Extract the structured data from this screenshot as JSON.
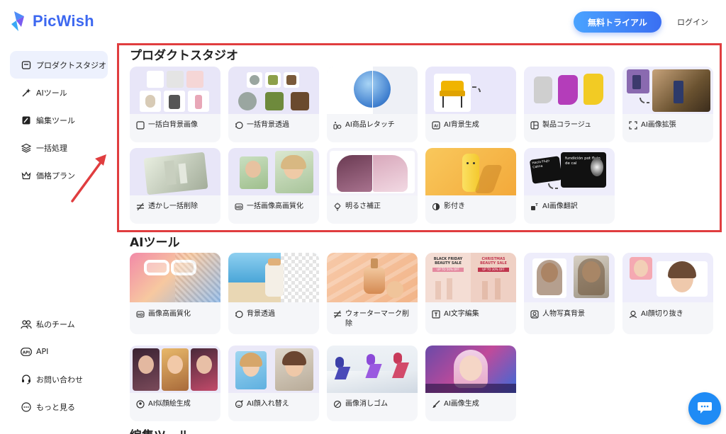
{
  "brand": {
    "name": "PicWish",
    "color": "#3d68f0"
  },
  "header": {
    "trial_button": "無料トライアル",
    "login_link": "ログイン"
  },
  "sidebar": {
    "items": [
      {
        "label": "プロダクトスタジオ",
        "icon": "studio-icon",
        "active": true
      },
      {
        "label": "AIツール",
        "icon": "ai-sparkle-icon"
      },
      {
        "label": "編集ツール",
        "icon": "edit-tool-icon"
      },
      {
        "label": "一括処理",
        "icon": "layers-icon"
      },
      {
        "label": "価格プラン",
        "icon": "crown-icon"
      }
    ],
    "bottom_items": [
      {
        "label": "私のチーム",
        "icon": "team-icon"
      },
      {
        "label": "API",
        "icon": "api-icon"
      },
      {
        "label": "お問い合わせ",
        "icon": "headset-icon"
      },
      {
        "label": "もっと見る",
        "icon": "more-icon"
      }
    ]
  },
  "sections": {
    "product_studio": {
      "title": "プロダクトスタジオ",
      "cards": [
        {
          "label": "一括白背景画像",
          "icon": "square-icon"
        },
        {
          "label": "一括背景透過",
          "icon": "transparent-bg-icon"
        },
        {
          "label": "AI商品レタッチ",
          "icon": "retouch-icon"
        },
        {
          "label": "AI背景生成",
          "icon": "ai-bg-icon"
        },
        {
          "label": "製品コラージュ",
          "icon": "collage-icon"
        },
        {
          "label": "AI画像拡張",
          "icon": "expand-icon"
        },
        {
          "label": "透かし一括削除",
          "icon": "watermark-icon"
        },
        {
          "label": "一括画像高画質化",
          "icon": "hd-icon"
        },
        {
          "label": "明るさ補正",
          "icon": "bulb-icon"
        },
        {
          "label": "影付き",
          "icon": "shadow-icon"
        },
        {
          "label": "AI画像翻訳",
          "icon": "translate-icon"
        }
      ]
    },
    "ai_tools": {
      "title": "AIツール",
      "cards": [
        {
          "label": "画像高画質化",
          "icon": "hd-icon"
        },
        {
          "label": "背景透過",
          "icon": "transparent-bg-icon"
        },
        {
          "label": "ウォーターマーク削除",
          "icon": "watermark-icon"
        },
        {
          "label": "AI文字編集",
          "icon": "text-edit-icon"
        },
        {
          "label": "人物写真背景",
          "icon": "portrait-bg-icon"
        },
        {
          "label": "AI顔切り抜き",
          "icon": "face-cut-icon"
        },
        {
          "label": "AI似顔絵生成",
          "icon": "avatar-icon"
        },
        {
          "label": "AI顔入れ替え",
          "icon": "face-swap-icon"
        },
        {
          "label": "画像消しゴム",
          "icon": "eraser-icon"
        },
        {
          "label": "AI画像生成",
          "icon": "brush-icon"
        }
      ]
    },
    "edit_tools": {
      "title": "編集ツール"
    }
  },
  "thumb_text": {
    "black_friday": "BLACK FRIDAY BEAUTY SALE",
    "black_friday_off": "UP TO 50% OFF",
    "christmas": "CHRISTMAS BEAUTY SALE",
    "christmas_off": "UP TO 30% OFF",
    "translate_left": "Hacia Flujo Calma",
    "translate_right": "fundición pot flujo de cal"
  },
  "colors": {
    "accent": "#3a6ff2",
    "highlight_border": "#e03d3f",
    "arrow": "#e03d3f",
    "chat": "#1f8bf5"
  }
}
